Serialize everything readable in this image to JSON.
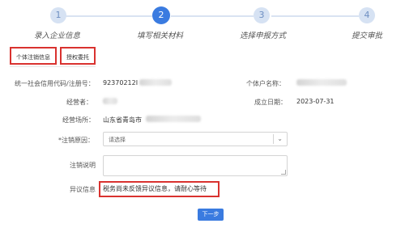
{
  "stepper": {
    "steps": [
      {
        "number": "1",
        "label": "录入企业信息",
        "state": "done"
      },
      {
        "number": "2",
        "label": "填写相关材料",
        "state": "active"
      },
      {
        "number": "3",
        "label": "选择申报方式",
        "state": "pending"
      },
      {
        "number": "4",
        "label": "提交审批",
        "state": "pending"
      }
    ]
  },
  "tabs": {
    "first": "个体注销信息",
    "second": "授权委托"
  },
  "form": {
    "credit_code_label": "统一社会信用代码/注册号：",
    "credit_code_value": "92370212I",
    "owner_name_label": "个体户名称：",
    "operator_label": "经营者：",
    "established_label": "成立日期：",
    "established_value": "2023-07-31",
    "premises_label": "经营场所：",
    "premises_value": "山东省青岛市",
    "reason_label": "*注销原因：",
    "reason_placeholder": "请选择",
    "note_label": "注销说明",
    "dispute_label": "异议信息",
    "dispute_value": "税务尚未反馈异议信息，请耐心等待"
  },
  "buttons": {
    "next": "下一步"
  },
  "colors": {
    "primary": "#3a7be0",
    "step_inactive": "#d6e2f3",
    "highlight": "#d9322f"
  }
}
